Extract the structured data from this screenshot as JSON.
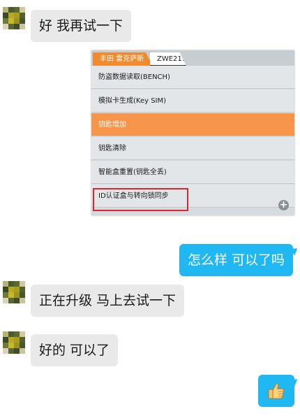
{
  "messages": [
    {
      "side": "in",
      "text": "好 我再试一下"
    },
    {
      "side": "in",
      "type": "image",
      "tabs": [
        "丰田 雷克萨斯",
        "ZWE211"
      ],
      "menu": [
        "防盗数据读取(BENCH)",
        "模拟卡生成(Key SIM)",
        "钥匙增加",
        "钥匙清除",
        "智能盒重置(钥匙全丢)",
        "ID认证盒与转向锁同步"
      ],
      "highlighted_item": "钥匙增加",
      "boxed_item": "ID认证盒与转向锁同步",
      "zoom_icon": "zoom-in-icon"
    },
    {
      "side": "out",
      "text": "怎么样  可以了吗"
    },
    {
      "side": "in",
      "text": "正在升级  马上去试一下"
    },
    {
      "side": "in",
      "text": "好的 可以了"
    },
    {
      "side": "out",
      "type": "emoji",
      "emoji": "thumbs-up-icon"
    }
  ],
  "colors": {
    "incoming_bubble": "#e9e9e9",
    "outgoing_bubble": "#1fb8f2",
    "menu_highlight": "#f7954b",
    "tab_active": "#f08a2c",
    "box_outline": "#e0242b"
  }
}
